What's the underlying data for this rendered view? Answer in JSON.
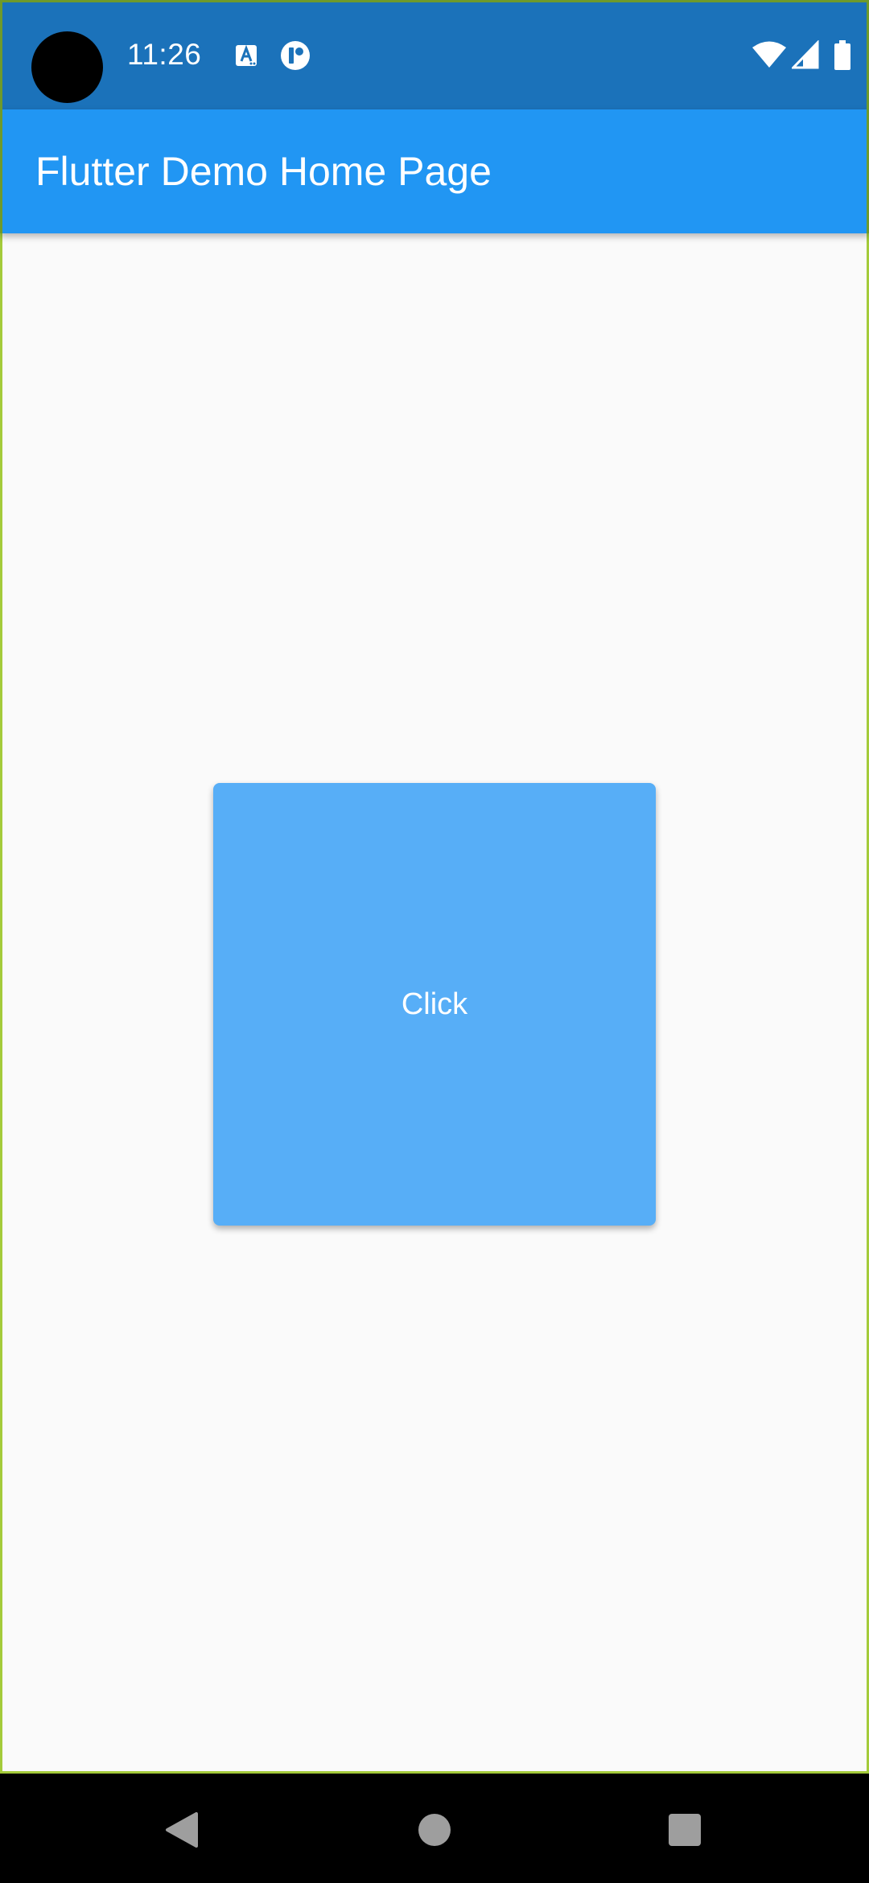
{
  "status_bar": {
    "time": "11:26",
    "icons": [
      "camera-cutout",
      "accessibility-notification-icon",
      "app-notification-icon",
      "wifi-icon",
      "cellular-signal-icon",
      "battery-icon"
    ]
  },
  "app_bar": {
    "title": "Flutter Demo Home Page"
  },
  "main": {
    "button_label": "Click"
  },
  "nav_bar": {
    "buttons": [
      "back-icon",
      "home-icon",
      "recents-icon"
    ]
  },
  "colors": {
    "status_bar": "#1B72BA",
    "app_bar": "#2196F3",
    "background": "#FAFAFA",
    "button": "#57AEF7",
    "frame_border": "#A4CB3A",
    "nav_bar": "#000000"
  }
}
